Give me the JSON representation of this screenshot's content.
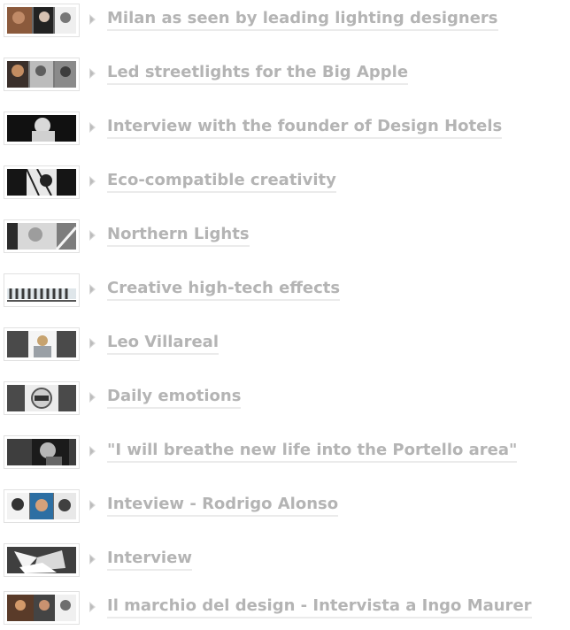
{
  "articles": [
    {
      "title": "Milan as seen by leading lighting designers",
      "thumbnail": "portraits-thumbnail"
    },
    {
      "title": "Led streetlights for the Big Apple",
      "thumbnail": "portraits-thumbnail"
    },
    {
      "title": "Interview with the founder of Design Hotels",
      "thumbnail": "portrait-thumbnail"
    },
    {
      "title": "Eco-compatible creativity",
      "thumbnail": "portrait-thumbnail"
    },
    {
      "title": "Northern Lights",
      "thumbnail": "portrait-thumbnail"
    },
    {
      "title": "Creative high-tech effects",
      "thumbnail": "pattern-thumbnail"
    },
    {
      "title": "Leo Villareal",
      "thumbnail": "portrait-thumbnail"
    },
    {
      "title": "Daily emotions",
      "thumbnail": "book-cover-thumbnail"
    },
    {
      "title": "\"I will breathe new life into the Portello area\"",
      "thumbnail": "portrait-thumbnail"
    },
    {
      "title": "Inteview - Rodrigo Alonso",
      "thumbnail": "portraits-thumbnail"
    },
    {
      "title": "Interview",
      "thumbnail": "lighting-object-thumbnail"
    },
    {
      "title": "Il marchio del design - Intervista a Ingo Maurer",
      "thumbnail": "portraits-thumbnail"
    }
  ],
  "colors": {
    "link": "#b4b4b4",
    "underline": "#ebebeb",
    "arrow": "#d8d8d8",
    "thumb_border": "#e1e1e1"
  }
}
